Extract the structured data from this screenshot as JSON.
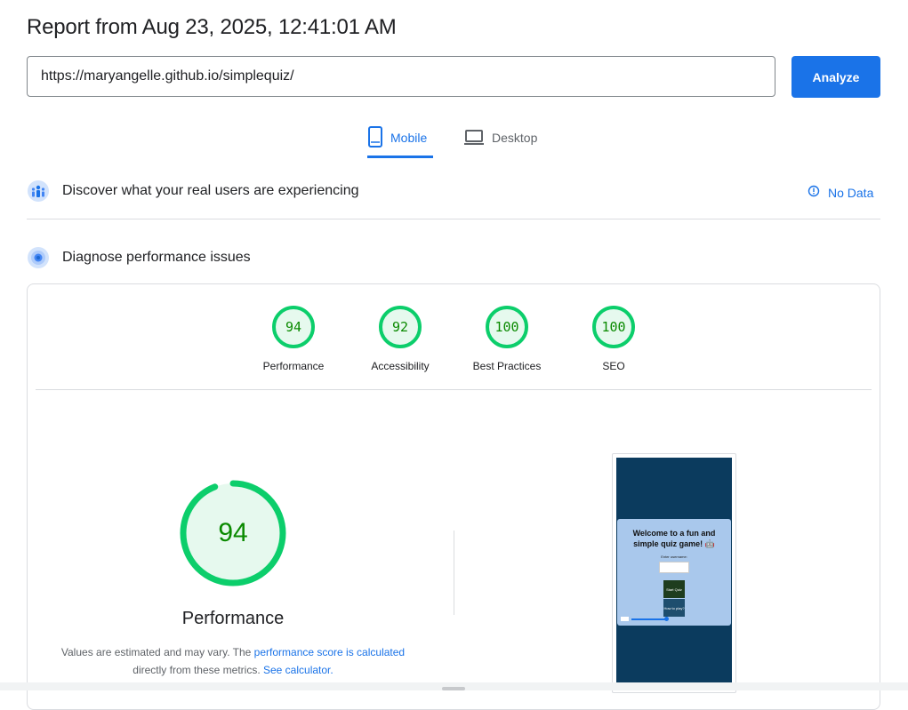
{
  "header": {
    "title": "Report from Aug 23, 2025, 12:41:01 AM"
  },
  "url_input": {
    "value": "https://maryangelle.github.io/simplequiz/"
  },
  "analyze_button": {
    "label": "Analyze"
  },
  "tabs": [
    {
      "label": "Mobile",
      "icon": "smartphone-icon",
      "selected": true
    },
    {
      "label": "Desktop",
      "icon": "laptop-icon",
      "selected": false
    }
  ],
  "field_data": {
    "title": "Discover what your real users are experiencing",
    "status": "No Data",
    "status_icon": "info-icon"
  },
  "lab_data": {
    "title": "Diagnose performance issues"
  },
  "scores": [
    {
      "label": "Performance",
      "value": "94"
    },
    {
      "label": "Accessibility",
      "value": "92"
    },
    {
      "label": "Best Practices",
      "value": "100"
    },
    {
      "label": "SEO",
      "value": "100"
    }
  ],
  "main_score": {
    "value": "94",
    "label": "Performance"
  },
  "description": {
    "text1": "Values are estimated and may vary. The ",
    "link1": "performance score is calculated",
    "text2": "directly from these metrics.",
    "link2": "See calculator."
  },
  "screenshot": {
    "title": "Welcome to a fun and simple quiz game! 🤖",
    "input_label": "Enter username:",
    "start_button": "Start Quiz",
    "how_button": "How to play?"
  },
  "colors": {
    "accent": "#1a73e8",
    "pass": "#0cce6b",
    "pass_text": "#0a8a00"
  }
}
